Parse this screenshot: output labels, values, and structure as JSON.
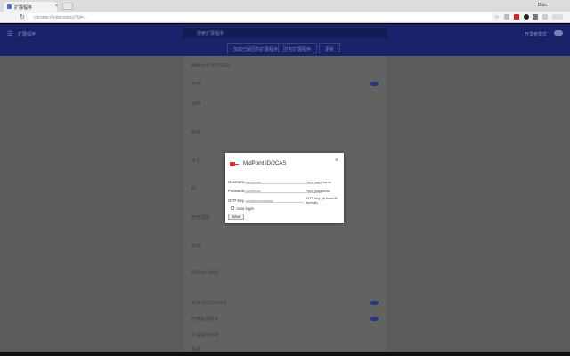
{
  "browser": {
    "tab_title": "扩展程序",
    "user": "Ditto",
    "url": "chrome://extensions/?id=..."
  },
  "header": {
    "title": "扩展程序",
    "search_placeholder": "搜索扩展程序",
    "dev_mode": "开发者模式",
    "buttons": [
      "加载已解压的扩展程序",
      "打包扩展程序",
      "更新"
    ]
  },
  "details": {
    "back_title": "MidPoint OTP/CAS",
    "rows": [
      "开启",
      "说明",
      "版本",
      "大小",
      "ID",
      "检查视图",
      "权限",
      "网站访问权限",
      "允许访问文件网址",
      "收集各项错误",
      "扩展程序选项",
      "来源"
    ]
  },
  "dialog": {
    "title": "MidPoint ID/2CAS",
    "close": "×",
    "fields": [
      {
        "label": "Username",
        "value": "••••••••••••",
        "hint": "Your user name"
      },
      {
        "label": "Password",
        "value": "••••••••••••",
        "hint": "Your password"
      },
      {
        "label": "OTP Key",
        "value": "••••••••••••••••••••••",
        "hint": "OTP key (in base32 format)"
      }
    ],
    "auto_login": "Auto login",
    "save": "Save"
  }
}
